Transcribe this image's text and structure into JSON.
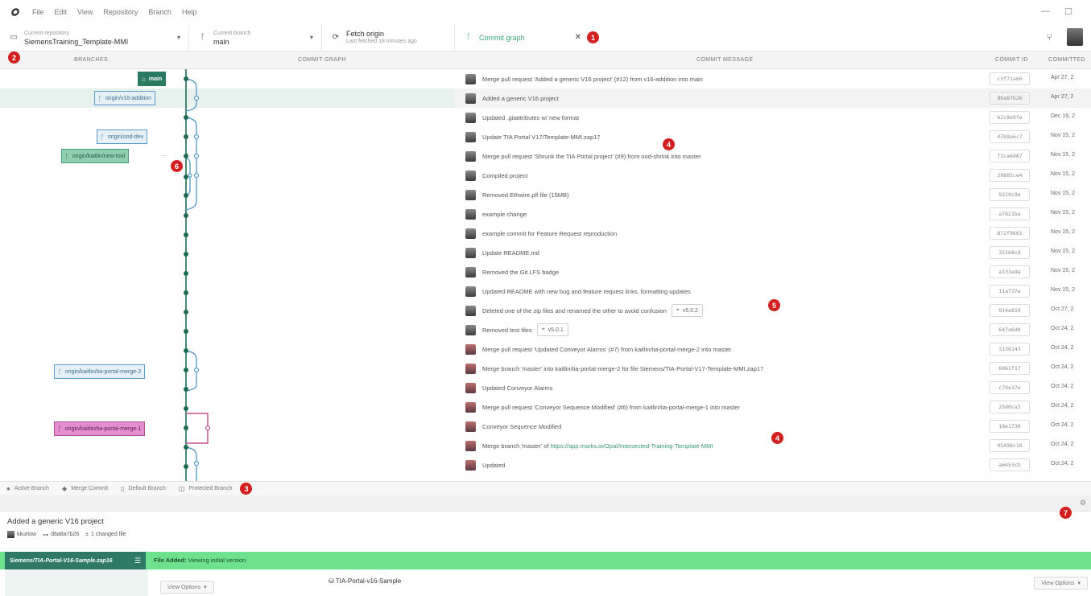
{
  "menubar": {
    "items": [
      "File",
      "Edit",
      "View",
      "Repository",
      "Branch",
      "Help"
    ]
  },
  "toolbar": {
    "repo": {
      "small": "Current repository",
      "main": "SiemensTraining_Template-MMI"
    },
    "branch": {
      "small": "Current branch",
      "main": "main"
    },
    "fetch": {
      "main": "Fetch origin",
      "small": "Last fetched 18 minutes ago"
    },
    "tab": {
      "label": "Commit graph"
    }
  },
  "columns": {
    "branches": "BRANCHES",
    "graph": "COMMIT GRAPH",
    "message": "COMMIT MESSAGE",
    "id": "COMMIT ID",
    "date": "COMMITTED"
  },
  "branch_tags": [
    {
      "label": "main",
      "style": "main",
      "icon": "main-branch-icon"
    },
    {
      "label": "origin/v16-addition",
      "style": "blue",
      "icon": "remote-branch-icon"
    },
    {
      "label": "origin/ood-dev",
      "style": "blue",
      "icon": "remote-branch-icon"
    },
    {
      "label": "origin/kaitlin/new-tool",
      "style": "green",
      "icon": "remote-branch-icon"
    },
    {
      "label": "origin/kaitlin/tia-portal-merge-2",
      "style": "blue",
      "icon": "remote-branch-icon"
    },
    {
      "label": "origin/kaitlin/tia-portal-merge-1",
      "style": "pink",
      "icon": "remote-branch-icon"
    }
  ],
  "more_label": "···",
  "commits": [
    {
      "msg": "Merge pull request 'Added a generic V16 project' (#12) from v16-addition into main",
      "id": "c3f71a66",
      "date": "Apr 27, 2",
      "avatar": "gray"
    },
    {
      "msg": "Added a generic V16 project",
      "id": "d6a87b26",
      "date": "Apr 27, 2",
      "avatar": "gray"
    },
    {
      "msg": "Updated .gitattributes w/ new format",
      "id": "b2c8e9fe",
      "date": "Dec 19, 2",
      "avatar": "gray"
    },
    {
      "msg": "Update TIA Portal V17/Template-MMI.zap17",
      "id": "47b9a6c7",
      "date": "Nov 15, 2",
      "avatar": "gray"
    },
    {
      "msg": "Merge pull request 'Shrunk the TIA Portal project' (#9) from ood-shrink into master",
      "id": "f1ca6987",
      "date": "Nov 15, 2",
      "avatar": "gray"
    },
    {
      "msg": "Compiled project",
      "id": "29802ce4",
      "date": "Nov 15, 2",
      "avatar": "gray"
    },
    {
      "msg": "Removed Ethwire.plf file (15MB)",
      "id": "9329c9a",
      "date": "Nov 15, 2",
      "avatar": "gray"
    },
    {
      "msg": "example change",
      "id": "a7821ba",
      "date": "Nov 15, 2",
      "avatar": "gray"
    },
    {
      "msg": "example commit for Feature Request reproduction",
      "id": "872f9661",
      "date": "Nov 15, 2",
      "avatar": "gray"
    },
    {
      "msg": "Update README.md",
      "id": "35168cd",
      "date": "Nov 15, 2",
      "avatar": "gray"
    },
    {
      "msg": "Removed the Git LFS badge",
      "id": "a131eda",
      "date": "Nov 15, 2",
      "avatar": "gray"
    },
    {
      "msg": "Updated README with new bug and feature request links, formatting updates",
      "id": "11a737a",
      "date": "Nov 15, 2",
      "avatar": "gray"
    },
    {
      "msg": "Deleted one of the zip files and renamed the other to avoid confusion",
      "id": "914a819",
      "date": "Oct 27, 2",
      "avatar": "gray",
      "tag": "v5.0.2"
    },
    {
      "msg": "Removed test files",
      "id": "647a6d9",
      "date": "Oct 24, 2",
      "avatar": "gray",
      "tag": "v5.0.1"
    },
    {
      "msg": "Merge pull request 'Updated Conveyor Alarms' (#7) from kaitlin/tia-portal-merge-2 into master",
      "id": "3138143",
      "date": "Oct 24, 2",
      "avatar": "red"
    },
    {
      "msg": "Merge branch 'master' into kaitlin/tia-portal-merge-2 for file Siemens/TIA-Portal-V17-Template-MMI.zap17",
      "id": "6961f17",
      "date": "Oct 24, 2",
      "avatar": "red"
    },
    {
      "msg": "Updated Conveyor Alarms",
      "id": "c79e37e",
      "date": "Oct 24, 2",
      "avatar": "red"
    },
    {
      "msg": "Merge pull request 'Conveyor Sequence Modified' (#6) from kaitlin/tia-portal-merge-1 into master",
      "id": "2580ca3",
      "date": "Oct 24, 2",
      "avatar": "red"
    },
    {
      "msg": "Conveyor Sequence Modified",
      "id": "18e1730",
      "date": "Oct 24, 2",
      "avatar": "red"
    },
    {
      "msg": "Merge branch 'master' of ",
      "link": "https://app.marks.io/Opal/Intersected-Training-Template-MMI",
      "id": "95496c18",
      "date": "Oct 24, 2",
      "avatar": "red"
    },
    {
      "msg": "Updated",
      "id": "a6453cb",
      "date": "Oct 24, 2",
      "avatar": "red"
    }
  ],
  "legend": [
    {
      "label": "Active Branch",
      "icon": "active-dot-icon"
    },
    {
      "label": "Merge Commit",
      "icon": "merge-commit-icon"
    },
    {
      "label": "Default Branch",
      "icon": "default-branch-icon"
    },
    {
      "label": "Protected Branch",
      "icon": "protected-branch-icon"
    }
  ],
  "badges": [
    "1",
    "2",
    "3",
    "4",
    "4",
    "5",
    "6",
    "7"
  ],
  "details": {
    "title": "Added a generic V16 project",
    "author": "kkurtow",
    "id": "d6a8a7b26",
    "changed": "1 changed file"
  },
  "file_bar": {
    "tab_label": "Siemens/TIA-Portal-V16-Sample.zap16",
    "status_bold": "File Added:",
    "status_text": " Viewing initial version"
  },
  "bottom": {
    "view_options_left": "View Options",
    "file_name": "TIA-Portal-v16-Sample",
    "view_options_right": "View Options"
  },
  "colors": {
    "accent": "#2a7a62",
    "graph_line": "#1d6a56",
    "branch_blue": "#5a9ec8",
    "branch_pink": "#c0508f",
    "file_added": "#6ee28e",
    "badge": "#d21f1f"
  }
}
